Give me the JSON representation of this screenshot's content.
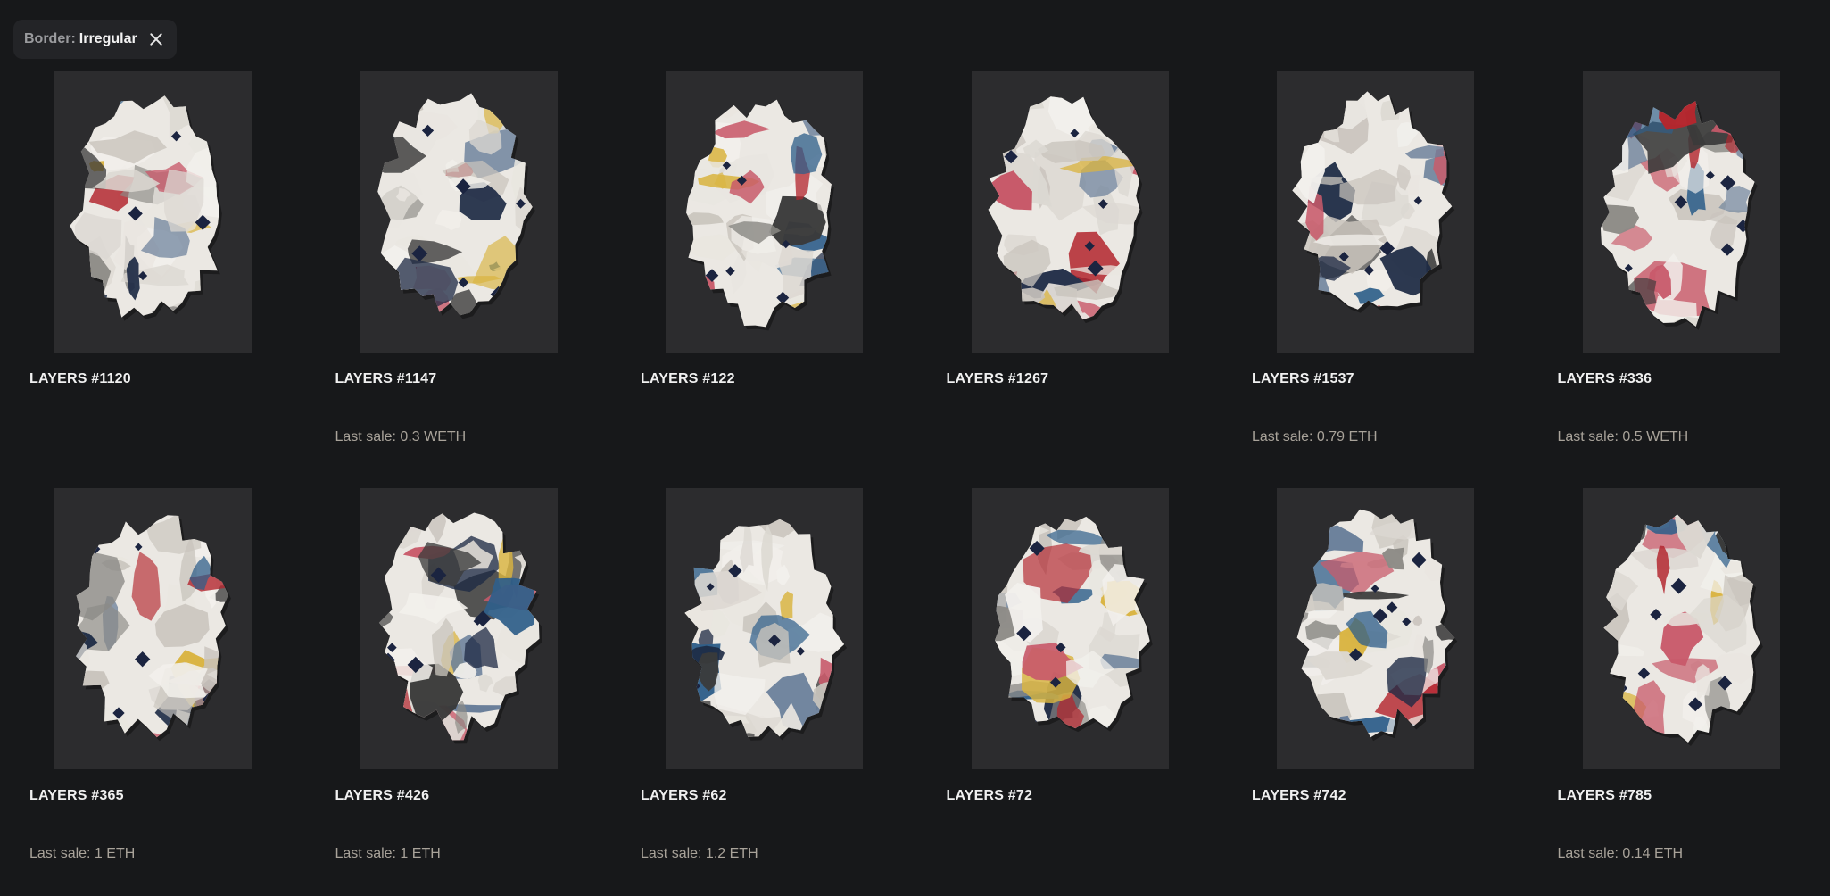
{
  "filter": {
    "key": "Border:",
    "value": "Irregular",
    "close_icon": "close-icon"
  },
  "items": [
    {
      "name": "LAYERS #1120",
      "sale": ""
    },
    {
      "name": "LAYERS #1147",
      "sale": "Last sale: 0.3 WETH"
    },
    {
      "name": "LAYERS #122",
      "sale": ""
    },
    {
      "name": "LAYERS #1267",
      "sale": ""
    },
    {
      "name": "LAYERS #1537",
      "sale": "Last sale: 0.79 ETH"
    },
    {
      "name": "LAYERS #336",
      "sale": "Last sale: 0.5 WETH"
    },
    {
      "name": "LAYERS #365",
      "sale": "Last sale: 1 ETH"
    },
    {
      "name": "LAYERS #426",
      "sale": "Last sale: 1 ETH"
    },
    {
      "name": "LAYERS #62",
      "sale": "Last sale: 1.2 ETH"
    },
    {
      "name": "LAYERS #72",
      "sale": ""
    },
    {
      "name": "LAYERS #742",
      "sale": ""
    },
    {
      "name": "LAYERS #785",
      "sale": "Last sale: 0.14 ETH"
    }
  ],
  "colors": {
    "background": "#17181a",
    "thumb_background": "#2c2c2e",
    "sale_text": "#a9a39a"
  }
}
